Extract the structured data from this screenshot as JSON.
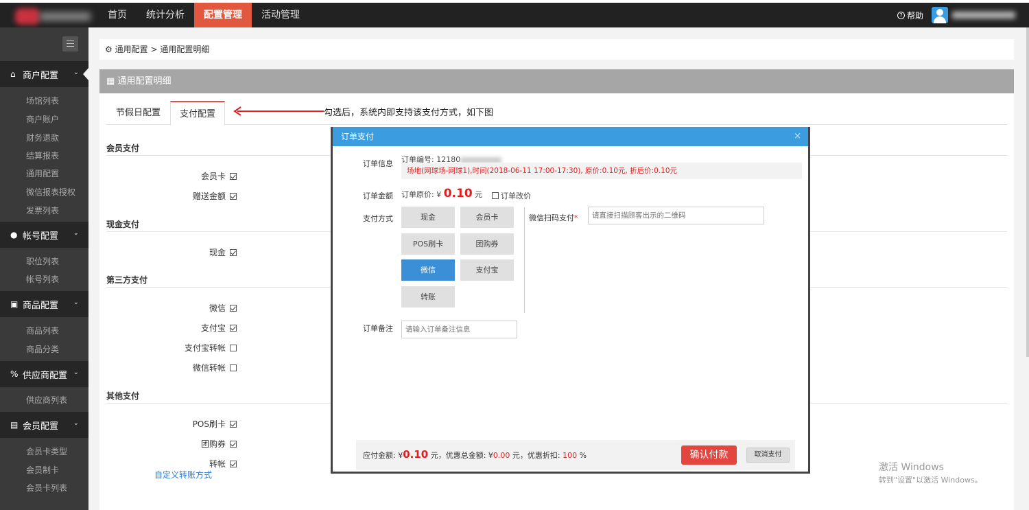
{
  "topnav": {
    "items": [
      "首页",
      "统计分析",
      "配置管理",
      "活动管理"
    ],
    "active_index": 2,
    "help_label": "帮助"
  },
  "sidebar": {
    "groups": [
      {
        "label": "商户配置",
        "icon": "home-icon",
        "items": [
          "场馆列表",
          "商户账户",
          "财务退款",
          "结算报表",
          "通用配置",
          "微信报表授权",
          "发票列表"
        ]
      },
      {
        "label": "帐号配置",
        "icon": "user-icon",
        "items": [
          "职位列表",
          "帐号列表"
        ]
      },
      {
        "label": "商品配置",
        "icon": "gift-icon",
        "items": [
          "商品列表",
          "商品分类"
        ]
      },
      {
        "label": "供应商配置",
        "icon": "link-icon",
        "items": [
          "供应商列表"
        ]
      },
      {
        "label": "会员配置",
        "icon": "card-icon",
        "items": [
          "会员卡类型",
          "会员制卡",
          "会员卡列表"
        ]
      }
    ]
  },
  "breadcrumb": {
    "home": "通用配置",
    "separator": ">",
    "current": "通用配置明细"
  },
  "panel": {
    "title": "通用配置明细"
  },
  "tabs": [
    "节假日配置",
    "支付配置"
  ],
  "annotation": "勾选后，系统内即支持该支付方式，如下图",
  "sections": {
    "member": {
      "title": "会员支付",
      "items": [
        {
          "label": "会员卡",
          "checked": true
        },
        {
          "label": "赠送金额",
          "checked": true
        }
      ]
    },
    "cash": {
      "title": "现金支付",
      "items": [
        {
          "label": "现金",
          "checked": true
        }
      ]
    },
    "third": {
      "title": "第三方支付",
      "items": [
        {
          "label": "微信",
          "checked": true
        },
        {
          "label": "支付宝",
          "checked": true
        },
        {
          "label": "支付宝转帐",
          "checked": false
        },
        {
          "label": "微信转帐",
          "checked": false
        }
      ]
    },
    "other": {
      "title": "其他支付",
      "items": [
        {
          "label": "POS刷卡",
          "checked": true
        },
        {
          "label": "团购券",
          "checked": true
        },
        {
          "label": "转帐",
          "checked": true
        }
      ]
    }
  },
  "custom_link": "自定义转账方式",
  "modal": {
    "title": "订单支付",
    "close": "×",
    "order_info_label": "订单信息",
    "order_no_label": "订单编号:",
    "order_no": "12180",
    "order_detail": "场地(网球场-网球1),时间(2018-06-11 17:00-17:30), 原价:0.10元, 折后价:0.10元",
    "amount_label": "订单金额",
    "original_price_label": "订单原价: ¥",
    "original_price": "0.10",
    "yuan": "元",
    "change_price_label": "订单改价",
    "pay_method_label": "支付方式",
    "pay_methods": [
      "现金",
      "会员卡",
      "POS刷卡",
      "团购券",
      "微信",
      "支付宝",
      "转账"
    ],
    "active_method": "微信",
    "wechat_scan_label": "微信扫码支付",
    "wechat_scan_required": "*",
    "wechat_scan_placeholder": "请直接扫描顾客出示的二维码",
    "remark_label": "订单备注",
    "remark_placeholder": "请输入订单备注信息",
    "footer": {
      "payable_label": "应付金额: ¥",
      "payable": "0.10",
      "discount_total_label": "元，优惠总金额: ¥",
      "discount_total": "0.00",
      "discount_rate_label": "元，优惠折扣:",
      "discount_rate": "100",
      "percent": "%",
      "confirm": "确认付款",
      "cancel": "取消支付"
    }
  },
  "watermark": {
    "line1": "激活 Windows",
    "line2": "转到\"设置\"以激活 Windows。"
  },
  "colors": {
    "accent": "#e2583f",
    "modal_head": "#3b9de0",
    "price": "#e02020",
    "confirm": "#e2463f"
  }
}
